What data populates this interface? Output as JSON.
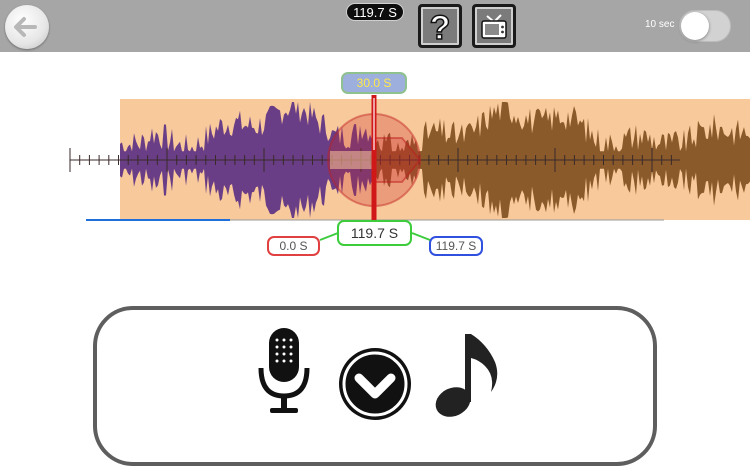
{
  "topbar": {
    "duration": "119.7 S",
    "toggle_label": "10 sec",
    "toggle_on": false,
    "icons": [
      "back-arrow-icon",
      "question-icon",
      "tv-icon"
    ]
  },
  "timeline": {
    "start_marker": "30.0 S",
    "current_position": "119.7 S",
    "range_start": "0.0 S",
    "range_end": "119.7 S",
    "colors": {
      "played": "#6a3e86",
      "unplayed": "#8b5a2b",
      "background": "#f8c99a",
      "playhead": "#d01818"
    }
  },
  "panel": {
    "icons": [
      "microphone-icon",
      "chevron-down-icon",
      "music-note-icon"
    ]
  }
}
